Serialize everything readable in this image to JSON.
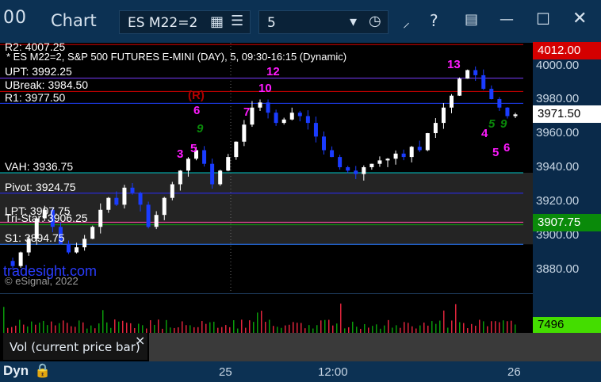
{
  "window": {
    "logo": "00",
    "title": "Chart",
    "symbol": "ES M22=2",
    "interval": "5",
    "colors": {
      "titlebar": "#0c3153",
      "axis": "#0a2a4a"
    }
  },
  "chart": {
    "header_line1": "R2: 4007.25",
    "header_line2": "* ES M22=2, S&P 500 FUTURES E-MINI (DAY), 5, 09:30-16:15 (Dynamic)",
    "level_labels": [
      {
        "text": "UPT: 3992.25"
      },
      {
        "text": "UBreak: 3984.50"
      },
      {
        "text": "R1: 3977.50"
      },
      {
        "text": "VAH: 3936.75"
      },
      {
        "text": "Pivot: 3924.75"
      },
      {
        "text": "LPT: 3907.75"
      },
      {
        "text": "Tri-Star: 3906.25"
      },
      {
        "text": "S1: 3894.75"
      }
    ],
    "watermark": "tradesight.com",
    "copyright": "© eSignal, 2022",
    "price_ticks": [
      "4000.00",
      "3980.00",
      "3960.00",
      "3940.00",
      "3920.00",
      "3900.00",
      "3880.00"
    ],
    "badges": [
      {
        "text": "4012.00",
        "bg": "#d40000",
        "fg": "#ffffff"
      },
      {
        "text": "3971.50",
        "bg": "#ffffff",
        "fg": "#000000"
      },
      {
        "text": "3907.75",
        "bg": "#0a8a0a",
        "fg": "#ffffff"
      }
    ],
    "markers": {
      "m1": "(R)",
      "m2": "6",
      "m3": "9",
      "m4": "3",
      "m5": "5",
      "m6": "12",
      "m7": "10",
      "m8": "7",
      "m9": "13",
      "m10": "4",
      "m11": "5",
      "m12": "6",
      "m13": "9",
      "m14": "5"
    }
  },
  "volume": {
    "panel_label": "Vol (current price bar)",
    "close_icon": "×",
    "value_badge": "7496",
    "badge_bg": "#44dd00"
  },
  "timeline": {
    "dyn_label": "Dyn",
    "ticks": [
      "25",
      "12:00",
      "26"
    ]
  }
}
